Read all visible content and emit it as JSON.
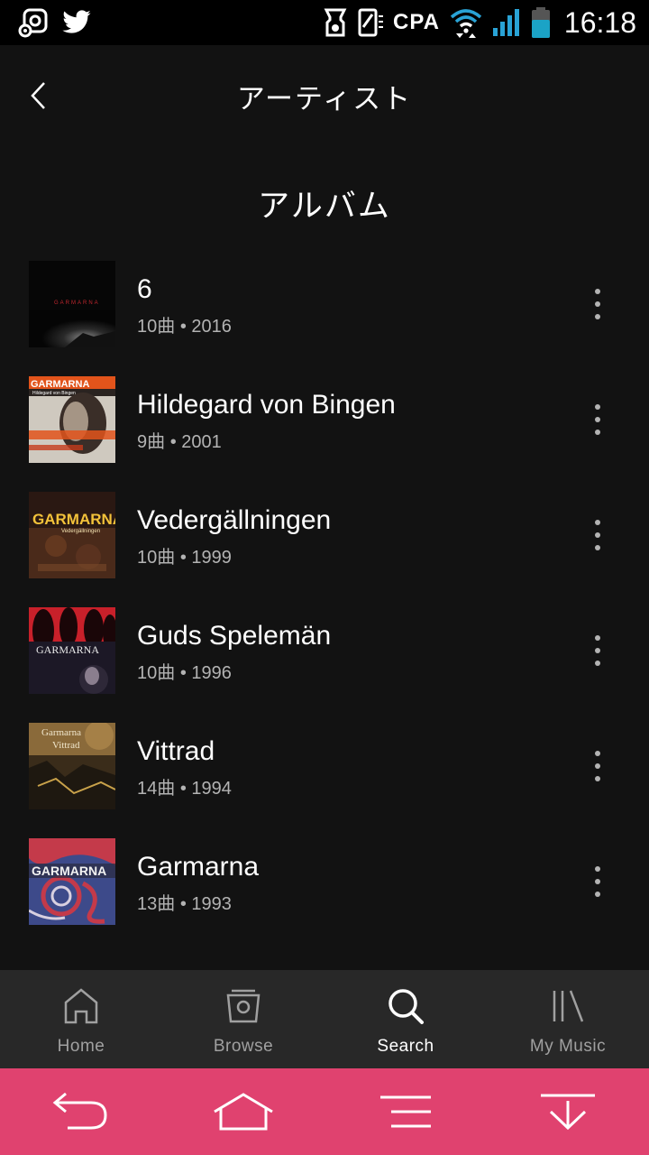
{
  "status_bar": {
    "left_icons": [
      "location-share-icon",
      "twitter-icon"
    ],
    "right_icons": [
      "device-icon",
      "sim-icon"
    ],
    "carrier": "CPA",
    "time": "16:18",
    "battery_color": "#1ba3c6",
    "signal_color": "#29a3d6"
  },
  "header": {
    "back_icon": "chevron-left-icon",
    "title": "アーティスト"
  },
  "section": {
    "title": "アルバム"
  },
  "albums": [
    {
      "title": "6",
      "tracks": "10曲",
      "year": "2016",
      "cover_text": "GARMARNA"
    },
    {
      "title": "Hildegard von Bingen",
      "tracks": "9曲",
      "year": "2001",
      "cover_text": "GARMARNA",
      "cover_subtext": "Hildegard von Bingen"
    },
    {
      "title": "Vedergällningen",
      "tracks": "10曲",
      "year": "1999",
      "cover_text": "GARMARNA",
      "cover_subtext": "Vedergällningen"
    },
    {
      "title": "Guds Spelemän",
      "tracks": "10曲",
      "year": "1996",
      "cover_text": "GARMARNA"
    },
    {
      "title": "Vittrad",
      "tracks": "14曲",
      "year": "1994",
      "cover_text": "Garmarna",
      "cover_subtext": "Vittrad"
    },
    {
      "title": "Garmarna",
      "tracks": "13曲",
      "year": "1993",
      "cover_text": "GARMARNA"
    }
  ],
  "meta_separator": "•",
  "bottom_nav": [
    {
      "label": "Home",
      "icon": "home-icon",
      "active": false
    },
    {
      "label": "Browse",
      "icon": "browse-icon",
      "active": false
    },
    {
      "label": "Search",
      "icon": "search-icon",
      "active": true
    },
    {
      "label": "My Music",
      "icon": "library-icon",
      "active": false
    }
  ],
  "soft_keys": [
    "back-arrow-icon",
    "home-outline-icon",
    "menu-icon",
    "download-arrow-icon"
  ],
  "colors": {
    "background": "#121212",
    "nav_background": "#282828",
    "soft_keys_background": "#e0426f",
    "secondary_text": "#b3b3b3"
  }
}
